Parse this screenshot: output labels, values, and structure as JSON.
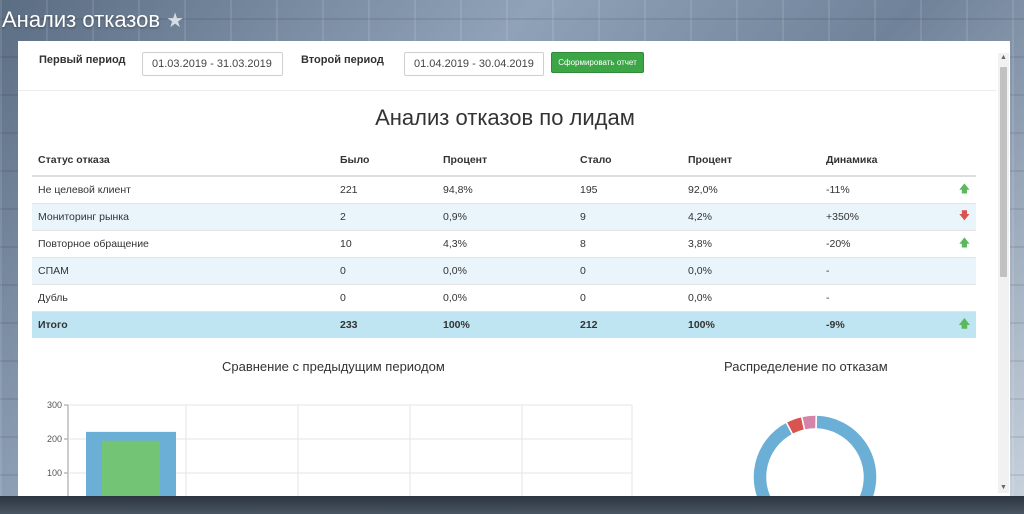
{
  "header": {
    "title": "Анализ отказов",
    "star_icon": "star-icon"
  },
  "filters": {
    "first_period_label": "Первый период",
    "first_period_value": "01.03.2019 - 31.03.2019",
    "second_period_label": "Второй период",
    "second_period_value": "01.04.2019 - 30.04.2019",
    "submit_label": "Сформировать отчет"
  },
  "report": {
    "title": "Анализ отказов по лидам",
    "columns": [
      "Статус отказа",
      "Было",
      "Процент",
      "Стало",
      "Процент",
      "Динамика"
    ],
    "rows": [
      {
        "status": "Не целевой клиент",
        "before": "221",
        "before_pct": "94,8%",
        "after": "195",
        "after_pct": "92,0%",
        "dynamics": "-11%",
        "trend": "up"
      },
      {
        "status": "Мониторинг рынка",
        "before": "2",
        "before_pct": "0,9%",
        "after": "9",
        "after_pct": "4,2%",
        "dynamics": "+350%",
        "trend": "down"
      },
      {
        "status": "Повторное обращение",
        "before": "10",
        "before_pct": "4,3%",
        "after": "8",
        "after_pct": "3,8%",
        "dynamics": "-20%",
        "trend": "up"
      },
      {
        "status": "СПАМ",
        "before": "0",
        "before_pct": "0,0%",
        "after": "0",
        "after_pct": "0,0%",
        "dynamics": "-",
        "trend": ""
      },
      {
        "status": "Дубль",
        "before": "0",
        "before_pct": "0,0%",
        "after": "0",
        "after_pct": "0,0%",
        "dynamics": "-",
        "trend": ""
      }
    ],
    "total": {
      "status": "Итого",
      "before": "233",
      "before_pct": "100%",
      "after": "212",
      "after_pct": "100%",
      "dynamics": "-9%",
      "trend": "up"
    }
  },
  "colors": {
    "up": "#5cb85c",
    "down": "#d9534f",
    "bar_before": "#6baed6",
    "bar_after": "#74c476",
    "donut_main": "#6baed6",
    "donut_red": "#d9534f",
    "donut_pink": "#d484a8"
  },
  "chart_data": [
    {
      "type": "bar",
      "title": "Сравнение с предыдущим периодом",
      "ylim": [
        0,
        300
      ],
      "yticks": [
        100,
        200,
        300
      ],
      "grid": true,
      "series": [
        {
          "values": [
            221
          ],
          "color": "#6baed6"
        },
        {
          "values": [
            195
          ],
          "color": "#74c476"
        }
      ]
    },
    {
      "type": "pie",
      "title": "Распределение по отказам",
      "values": [
        195,
        9,
        8
      ],
      "colors": [
        "#6baed6",
        "#d9534f",
        "#d484a8"
      ]
    }
  ]
}
